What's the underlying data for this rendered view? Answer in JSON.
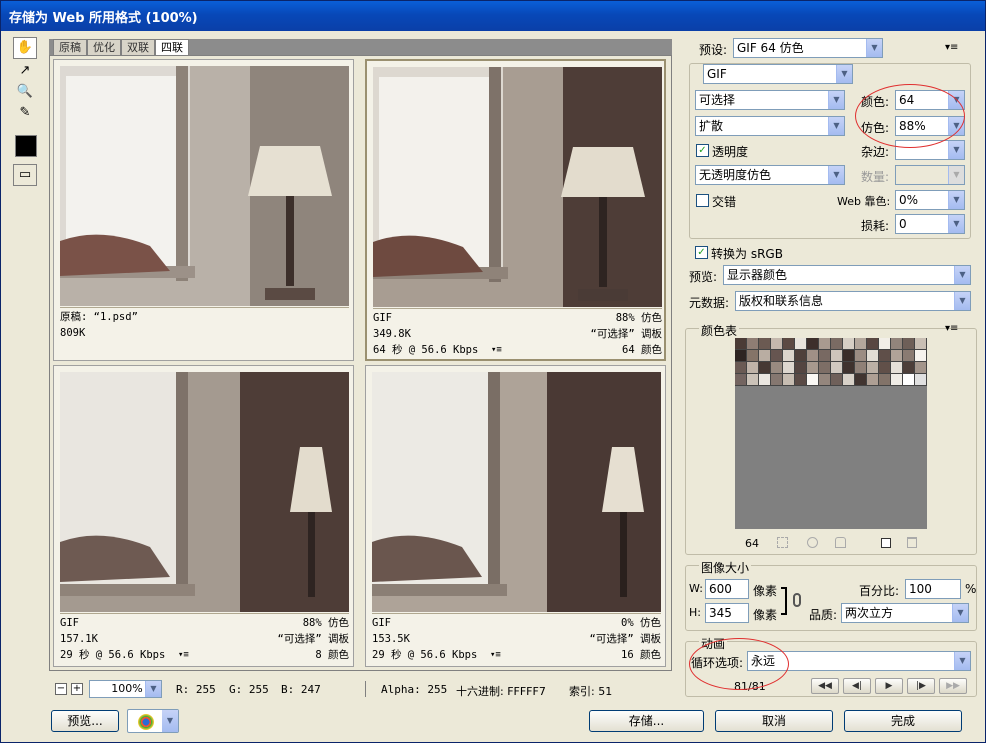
{
  "window": {
    "title": "存储为 Web 所用格式 (100%)"
  },
  "tabs": [
    "原稿",
    "优化",
    "双联",
    "四联"
  ],
  "panes": [
    {
      "line1_left": "原稿: “1.psd”",
      "line2_left": "809K"
    },
    {
      "line1_left": "GIF",
      "line1_right": "88% 仿色",
      "line2_left": "349.8K",
      "line2_right": "“可选择” 调板",
      "line3_left": "64 秒 @ 56.6 Kbps",
      "line3_right": "64 颜色"
    },
    {
      "line1_left": "GIF",
      "line1_right": "88% 仿色",
      "line2_left": "157.1K",
      "line2_right": "“可选择” 调板",
      "line3_left": "29 秒 @ 56.6 Kbps",
      "line3_right": "8 颜色"
    },
    {
      "line1_left": "GIF",
      "line1_right": "0% 仿色",
      "line2_left": "153.5K",
      "line2_right": "“可选择” 调板",
      "line3_left": "29 秒 @ 56.6 Kbps",
      "line3_right": "16 颜色"
    }
  ],
  "status": {
    "zoom": "100%",
    "r": "R: 255",
    "g": "G: 255",
    "b": "B: 247",
    "alpha": "Alpha: 255",
    "hex": "十六进制: FFFFF7",
    "index": "索引: 51"
  },
  "settings": {
    "preset_label": "预设:",
    "preset_value": "GIF 64 仿色",
    "format_value": "GIF",
    "reduction_value": "可选择",
    "colors_label": "颜色:",
    "colors_value": "64",
    "dither_algo_value": "扩散",
    "dither_label": "仿色:",
    "dither_value": "88%",
    "transparency_label": "透明度",
    "matte_label": "杂边:",
    "trans_dither_value": "无透明度仿色",
    "amount_label": "数量:",
    "interlaced_label": "交错",
    "websnap_label": "Web 靠色:",
    "websnap_value": "0%",
    "lossy_label": "损耗:",
    "lossy_value": "0",
    "srgb_label": "转换为 sRGB",
    "preview_label": "预览:",
    "preview_value": "显示器颜色",
    "metadata_label": "元数据:",
    "metadata_value": "版权和联系信息"
  },
  "color_table": {
    "title": "颜色表",
    "count": "64",
    "swatches": [
      "#4a3b36",
      "#8e7d74",
      "#6b5a52",
      "#c4b8ad",
      "#5c4a43",
      "#e8e4dc",
      "#3d2f2b",
      "#a89a8f",
      "#7a6b63",
      "#d6cfc5",
      "#b3a79c",
      "#584742",
      "#f2efe8",
      "#92847b",
      "#6e5f58",
      "#c9bfb4",
      "#2e2421",
      "#857468",
      "#b9ada2",
      "#665550",
      "#dcd5cc",
      "#4f403b",
      "#a09086",
      "#786962",
      "#cec5bb",
      "#3a2d29",
      "#9b8c82",
      "#e2ddd4",
      "#5f4f49",
      "#b0a398",
      "#8a7b72",
      "#f6f3ee",
      "#6a5a54",
      "#c0b4a9",
      "#463833",
      "#988a80",
      "#ddd7cf",
      "#544541",
      "#a7998e",
      "#7d6e66",
      "#d1c9c0",
      "#3f322e",
      "#8f8077",
      "#bbb0a5",
      "#615049",
      "#e5e0d8",
      "#4c3e39",
      "#a3958b",
      "#736460",
      "#cbc2b8",
      "#eae6e0",
      "#857770",
      "#c7bdb2",
      "#5a4a45",
      "#faf8f4",
      "#94867d",
      "#6f605a",
      "#d8d1c8",
      "#413430",
      "#ae9f94",
      "#827369",
      "#efece6",
      "#ffffff",
      "#e0e0e0"
    ]
  },
  "image_size": {
    "title": "图像大小",
    "w_label": "W:",
    "w_value": "600",
    "w_unit": "像素",
    "h_label": "H:",
    "h_value": "345",
    "h_unit": "像素",
    "percent_label": "百分比:",
    "percent_value": "100",
    "percent_unit": "%",
    "quality_label": "品质:",
    "quality_value": "两次立方"
  },
  "animation": {
    "title": "动画",
    "loop_label": "循环选项:",
    "loop_value": "永远",
    "frame": "81/81"
  },
  "buttons": {
    "preview": "预览...",
    "save": "存储...",
    "cancel": "取消",
    "done": "完成"
  }
}
